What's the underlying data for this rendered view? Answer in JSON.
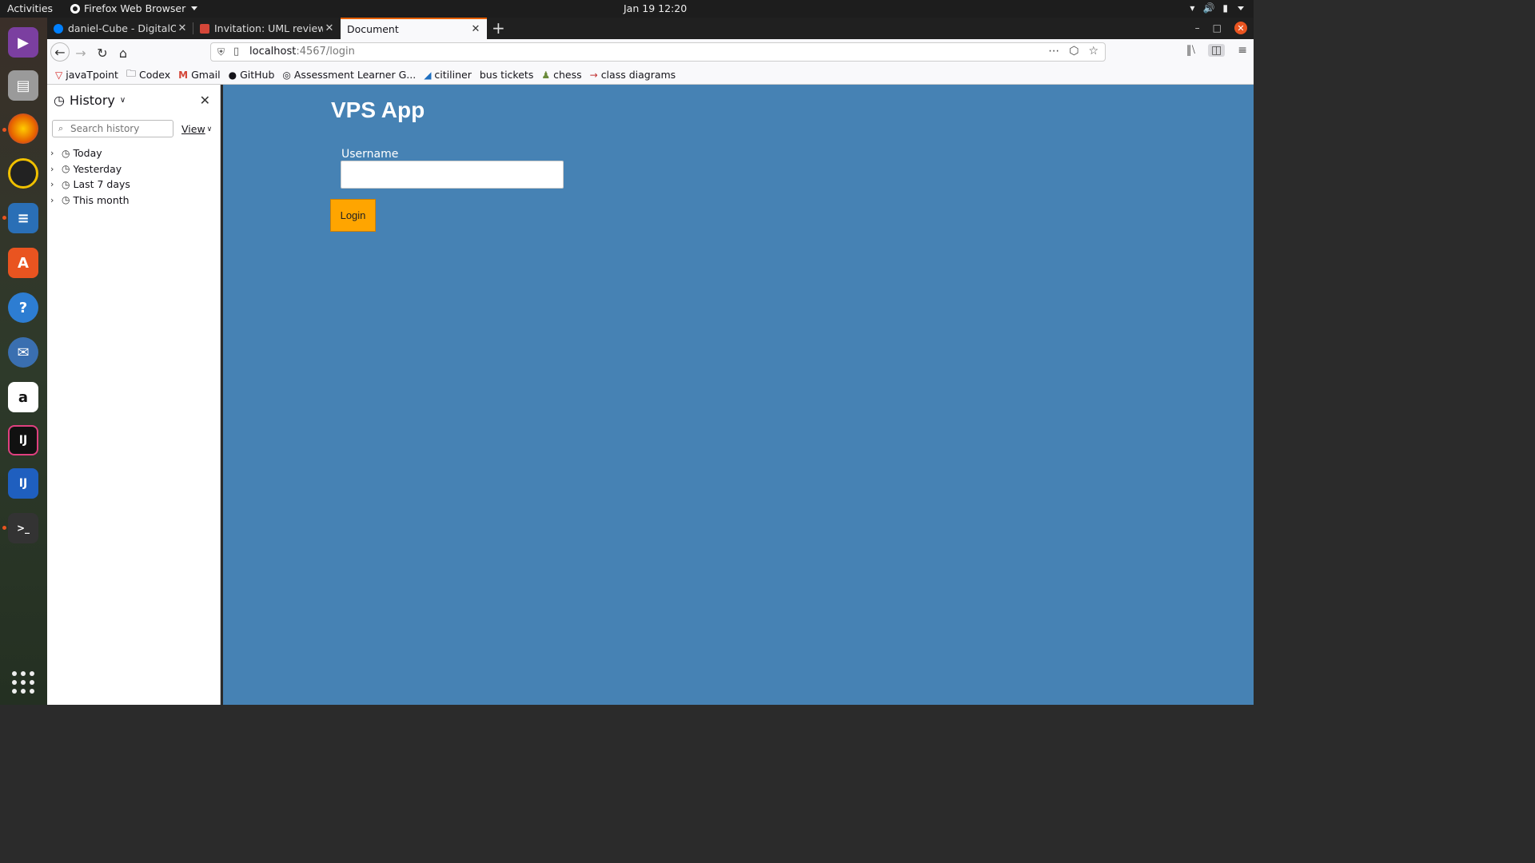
{
  "topbar": {
    "activities": "Activities",
    "app_menu": "Firefox Web Browser",
    "clock": "Jan 19  12:20"
  },
  "tabs": [
    {
      "title": "daniel-Cube - DigitalOce",
      "icon": "digitalocean-icon",
      "color": "#0080ff",
      "active": false
    },
    {
      "title": "Invitation: UML review se",
      "icon": "gmail-icon",
      "color": "#d44638",
      "active": false
    },
    {
      "title": "Document",
      "icon": "",
      "color": "",
      "active": true
    }
  ],
  "navbar": {
    "url_host": "localhost",
    "url_rest": ":4567/login"
  },
  "bookmarks": [
    {
      "label": "javaTpoint",
      "icon": "javatpoint-icon"
    },
    {
      "label": "Codex",
      "icon": "folder-icon"
    },
    {
      "label": "Gmail",
      "icon": "gmail-icon"
    },
    {
      "label": "GitHub",
      "icon": "github-icon"
    },
    {
      "label": "Assessment Learner G...",
      "icon": "globe-icon"
    },
    {
      "label": "citiliner",
      "icon": "citiliner-icon"
    },
    {
      "label": "bus tickets",
      "icon": ""
    },
    {
      "label": "chess",
      "icon": "chess-icon"
    },
    {
      "label": "class diagrams",
      "icon": "diagram-icon"
    }
  ],
  "sidebar": {
    "title": "History",
    "search_placeholder": "Search history",
    "view_label": "View",
    "items": [
      {
        "label": "Today"
      },
      {
        "label": "Yesterday"
      },
      {
        "label": "Last 7 days"
      },
      {
        "label": "This month"
      }
    ]
  },
  "page": {
    "title": "VPS App",
    "username_label": "Username",
    "username_value": "",
    "login_label": "Login",
    "background": "#4682b4",
    "button_color": "#ffa500"
  },
  "dock": [
    {
      "name": "video-player-icon",
      "color": "#7b3fa0"
    },
    {
      "name": "files-icon",
      "color": "#8a8a8a"
    },
    {
      "name": "firefox-icon",
      "color": "#e66000"
    },
    {
      "name": "rhythmbox-icon",
      "color": "#f0c000"
    },
    {
      "name": "writer-icon",
      "color": "#2a6fb6"
    },
    {
      "name": "software-center-icon",
      "color": "#e95420"
    },
    {
      "name": "help-icon",
      "color": "#2d7dd2"
    },
    {
      "name": "thunderbird-icon",
      "color": "#3a6fb0"
    },
    {
      "name": "amazon-icon",
      "color": "#ffffff"
    },
    {
      "name": "intellij-icon",
      "color": "#222222"
    },
    {
      "name": "intellij-ultimate-icon",
      "color": "#1f5fbf"
    },
    {
      "name": "terminal-icon",
      "color": "#333333"
    }
  ]
}
